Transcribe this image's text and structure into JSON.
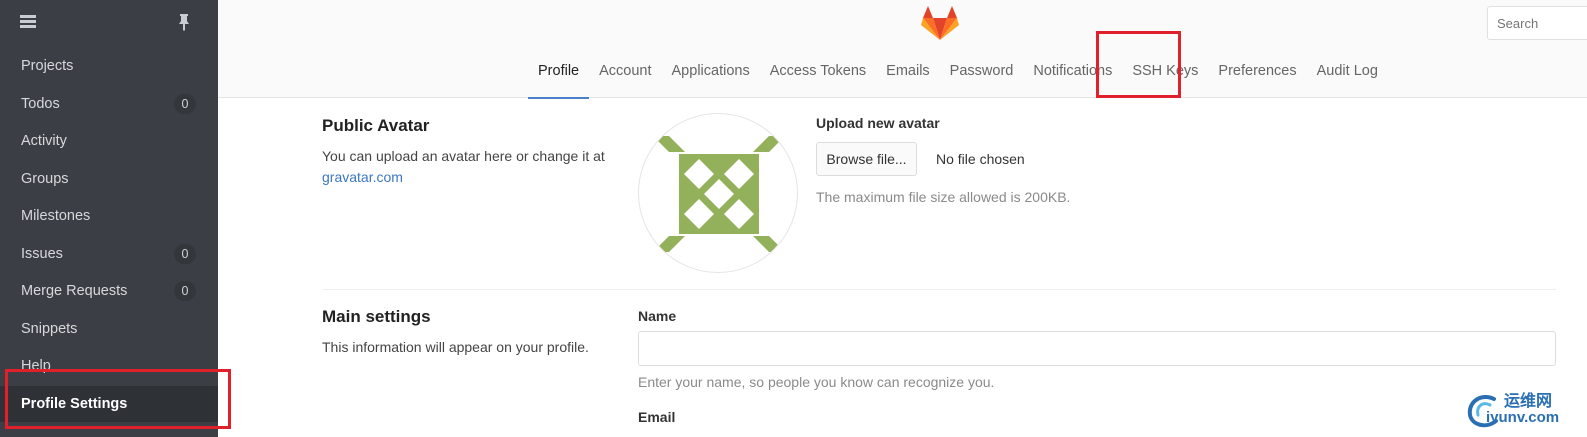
{
  "sidebar": {
    "items": [
      {
        "label": "Projects",
        "count": ""
      },
      {
        "label": "Todos",
        "count": "0"
      },
      {
        "label": "Activity",
        "count": ""
      },
      {
        "label": "Groups",
        "count": ""
      },
      {
        "label": "Milestones",
        "count": ""
      },
      {
        "label": "Issues",
        "count": "0"
      },
      {
        "label": "Merge Requests",
        "count": "0"
      },
      {
        "label": "Snippets",
        "count": ""
      },
      {
        "label": "Help",
        "count": ""
      },
      {
        "label": "Profile Settings",
        "count": ""
      }
    ],
    "active_item": "Profile Settings"
  },
  "header": {
    "search_placeholder": "Search",
    "tabs": [
      "Profile",
      "Account",
      "Applications",
      "Access Tokens",
      "Emails",
      "Password",
      "Notifications",
      "SSH Keys",
      "Preferences",
      "Audit Log"
    ],
    "active_tab": "Profile",
    "highlighted_tab": "SSH Keys"
  },
  "avatar_section": {
    "title": "Public Avatar",
    "desc": "You can upload an avatar here or change it at",
    "link": "gravatar.com",
    "upload_label": "Upload new avatar",
    "browse_label": "Browse file...",
    "no_file": "No file chosen",
    "size_hint": "The maximum file size allowed is 200KB."
  },
  "main_settings": {
    "title": "Main settings",
    "desc": "This information will appear on your profile.",
    "name_label": "Name",
    "name_value": "",
    "name_hint": "Enter your name, so people you know can recognize you.",
    "email_label": "Email"
  },
  "watermark": {
    "cn": "运维网",
    "en": "iyunv.com"
  },
  "colors": {
    "sidebar_bg": "#3b3f45",
    "highlight": "#e0202a",
    "link": "#3b78c2",
    "avatar_green": "#93b05a",
    "tab_underline": "#4a7fcb"
  }
}
